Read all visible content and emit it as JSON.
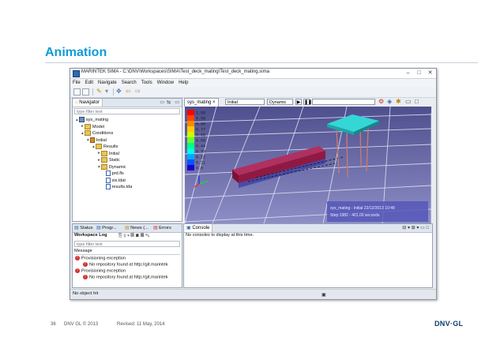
{
  "slide": {
    "title": "Animation",
    "page_number": "36",
    "copyright": "DNV GL © 2013",
    "revised": "Revised: 11 May, 2014",
    "logo_text": "DNV·GL"
  },
  "window": {
    "title": "MARINTEK SIMA - C:\\DNV\\Workspaces\\SIMA\\Test_deck_mating\\Test_deck_mating.sima",
    "controls": [
      "–",
      "□",
      "✕"
    ]
  },
  "menu": [
    "File",
    "Edit",
    "Navigate",
    "Search",
    "Tools",
    "Window",
    "Help"
  ],
  "navigator": {
    "tab_label": "Navigator",
    "filter_placeholder": "type filter text",
    "tree": [
      {
        "label": "sys_mating",
        "depth": 0,
        "toggle": "▴",
        "icon": "proj"
      },
      {
        "label": "Model",
        "depth": 1,
        "toggle": "▸",
        "icon": "folder"
      },
      {
        "label": "Conditions",
        "depth": 1,
        "toggle": "▴",
        "icon": "folder"
      },
      {
        "label": "Initial",
        "depth": 2,
        "toggle": "▴",
        "icon": "cond"
      },
      {
        "label": "Results",
        "depth": 3,
        "toggle": "▴",
        "icon": "folder"
      },
      {
        "label": "Initial",
        "depth": 4,
        "toggle": "▸",
        "icon": "folder"
      },
      {
        "label": "Static",
        "depth": 4,
        "toggle": "▸",
        "icon": "folder"
      },
      {
        "label": "Dynamic",
        "depth": 4,
        "toggle": "▴",
        "icon": "folder"
      },
      {
        "label": "prd.fls",
        "depth": 5,
        "toggle": "",
        "icon": "file"
      },
      {
        "label": "sis.ldat",
        "depth": 5,
        "toggle": "",
        "icon": "file"
      },
      {
        "label": "results.tda",
        "depth": 5,
        "toggle": "",
        "icon": "file"
      }
    ]
  },
  "viewer": {
    "tab_label": "sys_mating",
    "condition_value": "Initial",
    "mode_value": "Dynamic",
    "legend_values": [
      "1.99",
      "0.99",
      "0.88",
      "0.77",
      "0.66",
      "0.55",
      "0.44",
      "0.33",
      "0.22",
      "0.11",
      "0.0"
    ],
    "legend_colors": [
      "#ff0000",
      "#ff4400",
      "#ff8800",
      "#ffcc00",
      "#ccff00",
      "#66ff33",
      "#00ff88",
      "#00ffee",
      "#00aaff",
      "#0055ff",
      "#1a00cc"
    ],
    "info_lines": [
      "sys_mating - Initial   22/12/2013 10:48",
      "Step 1982 - 401.00 seconds"
    ]
  },
  "bottom_tabs": [
    "Status",
    "Progr...",
    "News (...",
    "Errors"
  ],
  "workspace_log": {
    "title": "Workspace Log",
    "filter_placeholder": "type filter text",
    "column_header": "Message",
    "rows": [
      {
        "text": "Provisioning exception",
        "level": 0
      },
      {
        "text": "No repository found at http://git.marintek",
        "level": 1
      },
      {
        "text": "Provisioning exception",
        "level": 0
      },
      {
        "text": "No repository found at http://git.marintek",
        "level": 1
      }
    ]
  },
  "console": {
    "tab_label": "Console",
    "message": "No consoles to display at this time."
  },
  "statusbar": {
    "text": "No object hit"
  }
}
